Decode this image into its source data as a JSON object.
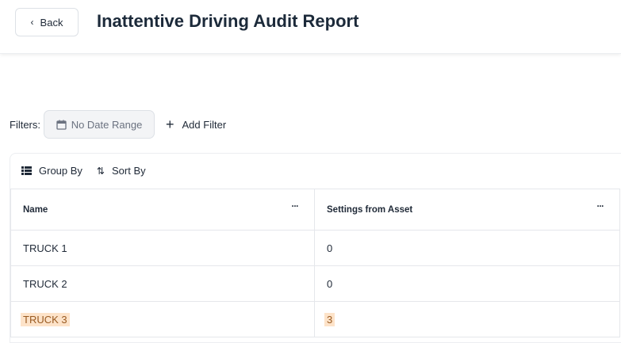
{
  "header": {
    "back_label": "Back",
    "title": "Inattentive Driving Audit Report"
  },
  "filters": {
    "label": "Filters:",
    "date_range": "No Date Range",
    "add_filter": "Add Filter"
  },
  "toolbar": {
    "group_by": "Group By",
    "sort_by": "Sort By"
  },
  "table": {
    "columns": [
      "Name",
      "Settings from Asset"
    ],
    "rows": [
      [
        "TRUCK 1",
        "0"
      ],
      [
        "TRUCK 2",
        "0"
      ],
      [
        "TRUCK 3",
        "3"
      ]
    ],
    "highlight_color": "#fde3c9"
  }
}
